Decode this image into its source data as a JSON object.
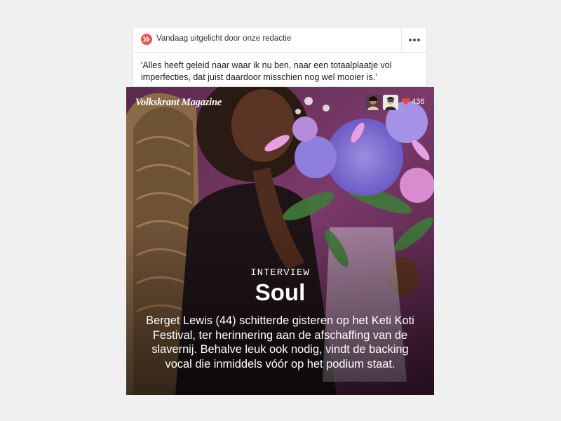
{
  "header": {
    "title": "Vandaag uitgelicht door onze redactie",
    "quote": "'Alles heeft geleid naar waar ik nu ben, naar een totaalplaatje vol imperfecties, dat juist daardoor misschien nog wel mooier is.'",
    "more_icon": "more-dots-icon",
    "brand_icon": "fast-forward-icon"
  },
  "article": {
    "logo": "Volkskrant Magazine",
    "likes": "436",
    "like_icon": "heart-icon",
    "kicker": "INTERVIEW",
    "title": "Soul",
    "summary": "Berget Lewis (44) schitterde gisteren op het Keti Koti Festival, ter herinnering aan de afschaffing van de slavernij. Behalve leuk ook nodig, vindt de backing vocal die inmiddels vóór op het podium staat."
  },
  "colors": {
    "brand_red": "#f0544f",
    "heart_red": "#e8453c",
    "background": "#f0f0f0"
  }
}
